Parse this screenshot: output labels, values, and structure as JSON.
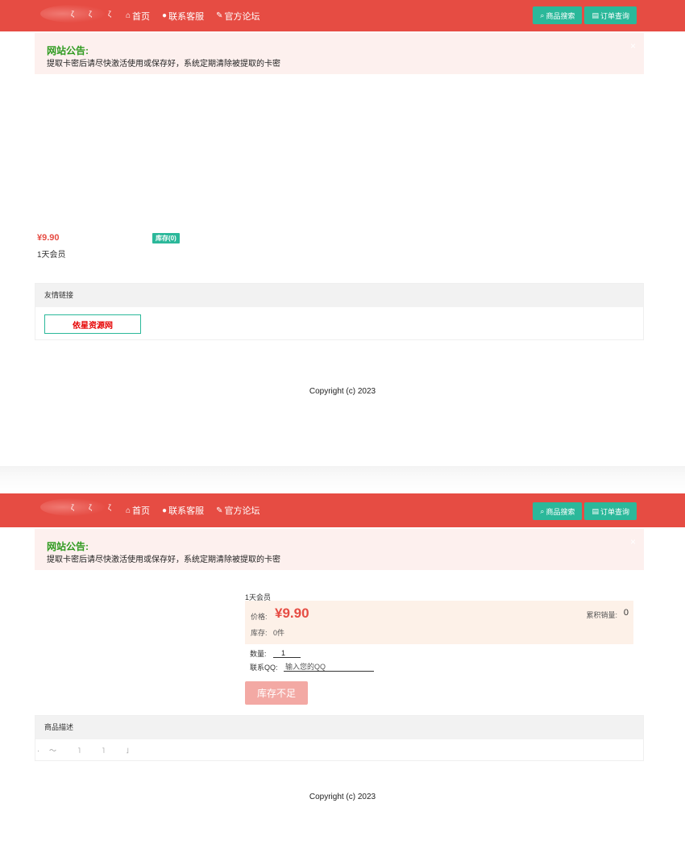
{
  "nav": {
    "links": [
      {
        "icon": "⌂",
        "label": "首页"
      },
      {
        "icon": "●",
        "label": "联系客服"
      },
      {
        "icon": "✎",
        "label": "官方论坛"
      }
    ],
    "buttons": [
      {
        "icon": "🔍",
        "label": "商品搜索"
      },
      {
        "icon": "▤",
        "label": "订单查询"
      }
    ]
  },
  "notice": {
    "title": "网站公告:",
    "text": "提取卡密后请尽快激活使用或保存好，系统定期清除被提取的卡密",
    "close": "×"
  },
  "list_page": {
    "product": {
      "price": "¥9.90",
      "stock_tag": "库存(0)",
      "name": "1天会员"
    },
    "links_card": {
      "title": "友情链接",
      "links": [
        "依星资源网"
      ]
    },
    "copyright": "Copyright (c) 2023"
  },
  "detail_page": {
    "name": "1天会员",
    "price_label": "价格:",
    "price": "¥9.90",
    "stock_label": "库存:",
    "stock_value": "0件",
    "sales_label": "累积销量:",
    "sales_value": "0",
    "qty_label": "数量:",
    "qty_value": "1",
    "qq_label": "联系QQ:",
    "qq_placeholder": "输入您的QQ",
    "oos_button": "库存不足",
    "desc_title": "商品描述",
    "copyright": "Copyright (c) 2023"
  },
  "colors": {
    "brand": "#e64c43",
    "accent": "#2bb89a",
    "notice_bg": "#fdf0ee"
  }
}
